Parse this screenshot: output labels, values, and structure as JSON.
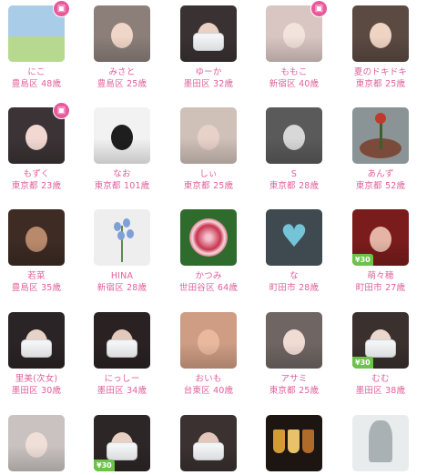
{
  "profiles": [
    {
      "name": "にこ",
      "area": "豊島区",
      "age": "48歳",
      "badge": "pin",
      "style": "scene",
      "c1": "#9fcbe9",
      "c2": "#b7d98f"
    },
    {
      "name": "みさと",
      "area": "豊島区",
      "age": "25歳",
      "badge": "",
      "style": "face",
      "c1": "#8c7f7a",
      "c2": "#f0d6c8"
    },
    {
      "name": "ゆーか",
      "area": "墨田区",
      "age": "32歳",
      "badge": "",
      "style": "mask",
      "c1": "#3a3232",
      "c2": "#e9d2c4"
    },
    {
      "name": "ももこ",
      "area": "新宿区",
      "age": "40歳",
      "badge": "pin",
      "style": "face",
      "c1": "#d9c6c2",
      "c2": "#f2e3dc"
    },
    {
      "name": "夏のドキドキ",
      "area": "東京都",
      "age": "25歳",
      "badge": "",
      "style": "face",
      "c1": "#5b4a42",
      "c2": "#efd4c4"
    },
    {
      "name": "もずく",
      "area": "東京都",
      "age": "23歳",
      "badge": "pin",
      "style": "face",
      "c1": "#3b3335",
      "c2": "#f3d8d2"
    },
    {
      "name": "なお",
      "area": "東京都",
      "age": "101歳",
      "badge": "",
      "style": "face",
      "c1": "#f2f2f2",
      "c2": "#1e1e1e"
    },
    {
      "name": "しぃ",
      "area": "東京都",
      "age": "25歳",
      "badge": "",
      "style": "face",
      "c1": "#cfc0b8",
      "c2": "#e8d1c8"
    },
    {
      "name": "S",
      "area": "東京都",
      "age": "28歳",
      "badge": "",
      "style": "face",
      "c1": "#5a5a5a",
      "c2": "#d8d8d8"
    },
    {
      "name": "あんず",
      "area": "東京都",
      "age": "52歳",
      "badge": "",
      "style": "plant",
      "c1": "#8a9496",
      "c2": "#7b4a3a"
    },
    {
      "name": "若菜",
      "area": "豊島区",
      "age": "35歳",
      "badge": "",
      "style": "face",
      "c1": "#3d2b24",
      "c2": "#b9896c"
    },
    {
      "name": "HINA",
      "area": "新宿区",
      "age": "28歳",
      "badge": "",
      "style": "flower",
      "c1": "#eeeeee",
      "c2": "#7ea0d6"
    },
    {
      "name": "かつみ",
      "area": "世田谷区",
      "age": "64歳",
      "badge": "",
      "style": "rose",
      "c1": "#2f6b2d",
      "c2": "#c8334f"
    },
    {
      "name": "な",
      "area": "町田市",
      "age": "28歳",
      "badge": "",
      "style": "heart",
      "c1": "#3f4a50",
      "c2": "#74c4d8"
    },
    {
      "name": "萌々穂",
      "area": "町田市",
      "age": "27歳",
      "badge": "",
      "style": "face",
      "c1": "#7a1c1c",
      "c2": "#e5b4a6",
      "price": "¥30"
    },
    {
      "name": "里美(次女)",
      "area": "墨田区",
      "age": "30歳",
      "badge": "",
      "style": "mask",
      "c1": "#2b2426",
      "c2": "#e7d2c8"
    },
    {
      "name": "にっしー",
      "area": "墨田区",
      "age": "34歳",
      "badge": "",
      "style": "mask",
      "c1": "#2a2222",
      "c2": "#e2c9bc"
    },
    {
      "name": "おいも",
      "area": "台東区",
      "age": "40歳",
      "badge": "",
      "style": "face",
      "c1": "#cf9d84",
      "c2": "#e9b99e"
    },
    {
      "name": "アサミ",
      "area": "東京都",
      "age": "25歳",
      "badge": "",
      "style": "face",
      "c1": "#6f6663",
      "c2": "#f1dcd4"
    },
    {
      "name": "むむ",
      "area": "墨田区",
      "age": "38歳",
      "badge": "",
      "style": "mask",
      "c1": "#3a302e",
      "c2": "#ecd7cd",
      "price": "¥30"
    },
    {
      "name": "",
      "area": "",
      "age": "",
      "badge": "",
      "style": "face",
      "c1": "#c9c2c0",
      "c2": "#efdfd8"
    },
    {
      "name": "",
      "area": "",
      "age": "",
      "badge": "",
      "style": "mask",
      "c1": "#2d2626",
      "c2": "#e9d0c4",
      "price": "¥30"
    },
    {
      "name": "",
      "area": "",
      "age": "",
      "badge": "",
      "style": "mask",
      "c1": "#3a3130",
      "c2": "#e3c7bb"
    },
    {
      "name": "",
      "area": "",
      "age": "",
      "badge": "",
      "style": "drinks",
      "c1": "#1c1512",
      "c2": "#d49b34"
    },
    {
      "name": "",
      "area": "",
      "age": "",
      "badge": "",
      "style": "snow",
      "c1": "#9aa2a6",
      "c2": "#e9eced"
    }
  ]
}
